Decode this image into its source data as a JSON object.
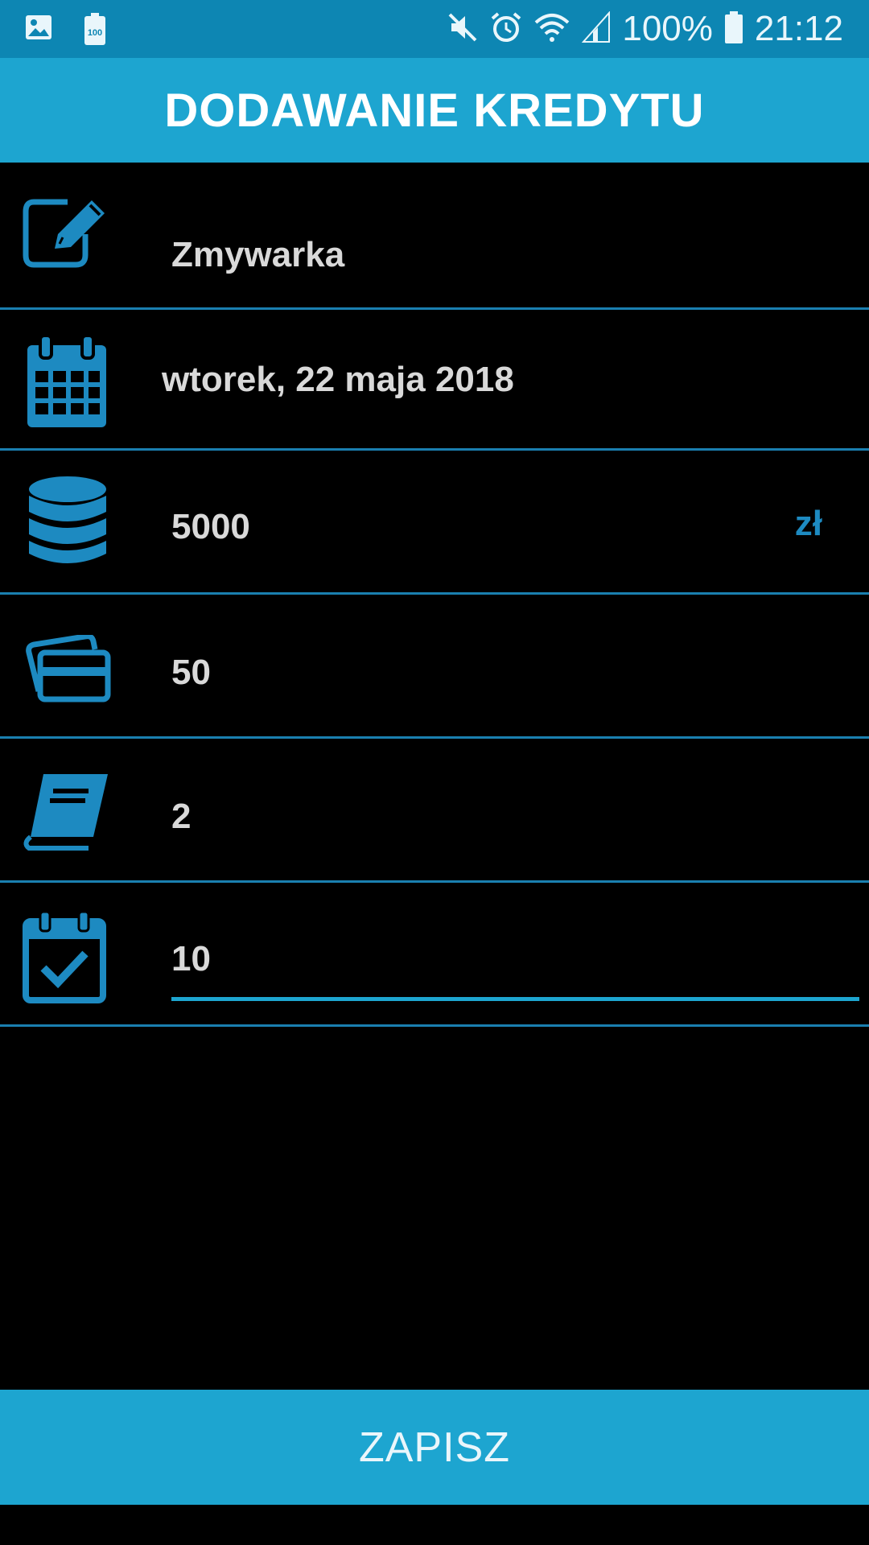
{
  "status_bar": {
    "battery_percent": "100%",
    "time": "21:12",
    "icons": [
      "image-icon",
      "battery-saver-icon",
      "mute-icon",
      "alarm-icon",
      "wifi-icon",
      "signal-icon",
      "battery-icon"
    ]
  },
  "header": {
    "title": "DODAWANIE KREDYTU"
  },
  "form": {
    "name": {
      "value": "Zmywarka",
      "icon": "edit-icon"
    },
    "date": {
      "value": "wtorek, 22 maja 2018",
      "icon": "calendar-icon"
    },
    "amount": {
      "value": "5000",
      "unit": "zł",
      "icon": "coins-stack-icon"
    },
    "installment": {
      "value": "50",
      "icon": "cards-icon"
    },
    "interest": {
      "value": "2",
      "icon": "book-icon"
    },
    "duration": {
      "value": "10",
      "icon": "calendar-check-icon"
    }
  },
  "actions": {
    "save_label": "ZAPISZ"
  },
  "colors": {
    "status_bar": "#0d86b3",
    "accent": "#1da5d0",
    "icon": "#1d8ac1",
    "text": "#d9d9d9",
    "background": "#000000"
  }
}
